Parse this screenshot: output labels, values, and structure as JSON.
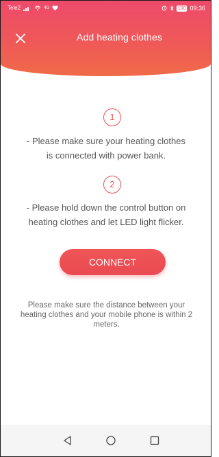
{
  "status": {
    "carrier": "Tele2",
    "network": "4G",
    "battery": "100",
    "time": "09:36"
  },
  "header": {
    "title": "Add heating clothes",
    "close_icon": "close-icon"
  },
  "steps": [
    {
      "number": "1",
      "line1": "- Please make sure your heating clothes",
      "line2": "is connected with power bank."
    },
    {
      "number": "2",
      "line1": "- Please hold down the control button on",
      "line2": "heating clothes and let LED light flicker."
    }
  ],
  "connect_label": "CONNECT",
  "note": {
    "line1": "Please make sure the distance between your",
    "line2": "heating clothes and your mobile phone is within 2",
    "line3": "meters."
  },
  "navbar": {
    "back_icon": "back-triangle-icon",
    "home_icon": "home-circle-icon",
    "recents_icon": "recents-square-icon"
  },
  "colors": {
    "accent": "#ef5356",
    "header_top": "#ee4a6b",
    "header_bottom": "#f06b48"
  }
}
